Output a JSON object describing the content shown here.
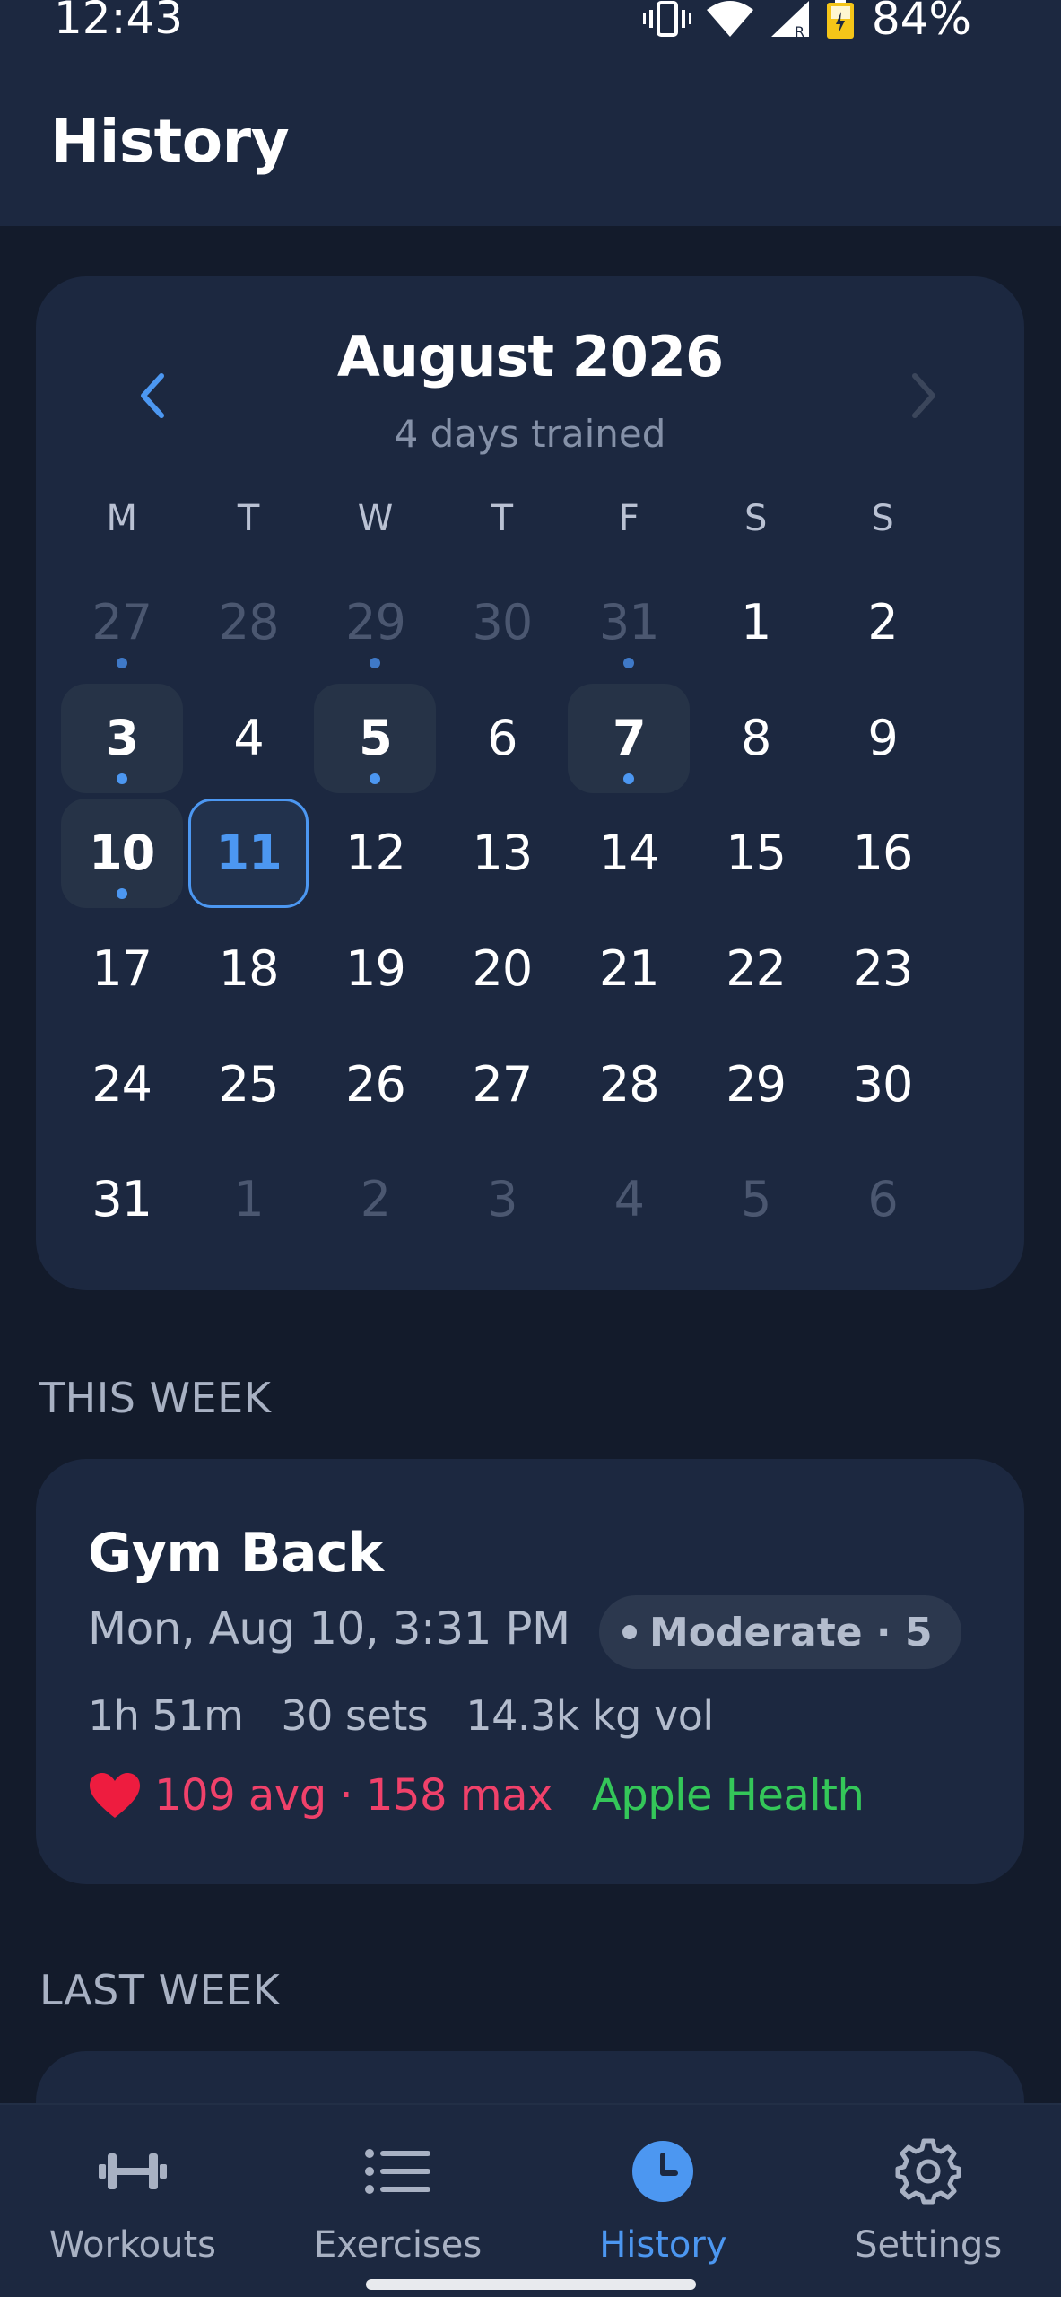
{
  "status_bar": {
    "time": "12:43",
    "battery": "84%"
  },
  "app_bar": {
    "title": "History"
  },
  "calendar": {
    "month_label": "August 2026",
    "subtitle": "4 days trained",
    "weekdays": [
      "M",
      "T",
      "W",
      "T",
      "F",
      "S",
      "S"
    ],
    "days": [
      {
        "label": "27",
        "other": true,
        "dot": true
      },
      {
        "label": "28",
        "other": true
      },
      {
        "label": "29",
        "other": true,
        "dot": true
      },
      {
        "label": "30",
        "other": true
      },
      {
        "label": "31",
        "other": true,
        "dot": true
      },
      {
        "label": "1"
      },
      {
        "label": "2"
      },
      {
        "label": "3",
        "trained": true,
        "dot": true
      },
      {
        "label": "4"
      },
      {
        "label": "5",
        "trained": true,
        "dot": true
      },
      {
        "label": "6"
      },
      {
        "label": "7",
        "trained": true,
        "dot": true
      },
      {
        "label": "8"
      },
      {
        "label": "9"
      },
      {
        "label": "10",
        "trained": true,
        "dot": true
      },
      {
        "label": "11",
        "today": true
      },
      {
        "label": "12"
      },
      {
        "label": "13"
      },
      {
        "label": "14"
      },
      {
        "label": "15"
      },
      {
        "label": "16"
      },
      {
        "label": "17"
      },
      {
        "label": "18"
      },
      {
        "label": "19"
      },
      {
        "label": "20"
      },
      {
        "label": "21"
      },
      {
        "label": "22"
      },
      {
        "label": "23"
      },
      {
        "label": "24"
      },
      {
        "label": "25"
      },
      {
        "label": "26"
      },
      {
        "label": "27"
      },
      {
        "label": "28"
      },
      {
        "label": "29"
      },
      {
        "label": "30"
      },
      {
        "label": "31"
      },
      {
        "label": "1",
        "other": true
      },
      {
        "label": "2",
        "other": true
      },
      {
        "label": "3",
        "other": true
      },
      {
        "label": "4",
        "other": true
      },
      {
        "label": "5",
        "other": true
      },
      {
        "label": "6",
        "other": true
      }
    ]
  },
  "sections": {
    "this_week": "THIS WEEK",
    "last_week": "LAST WEEK"
  },
  "workout": {
    "title": "Gym Back",
    "date": "Mon, Aug 10, 3:31 PM",
    "intensity": "Moderate · 5",
    "duration": "1h 51m",
    "sets": "30 sets",
    "volume": "14.3k kg vol",
    "heart_rate": "109 avg · 158 max",
    "source": "Apple Health"
  },
  "nav": {
    "items": [
      {
        "label": "Workouts",
        "icon": "dumbbell-icon"
      },
      {
        "label": "Exercises",
        "icon": "list-icon"
      },
      {
        "label": "History",
        "icon": "clock-icon",
        "active": true
      },
      {
        "label": "Settings",
        "icon": "gear-icon"
      }
    ]
  },
  "colors": {
    "background": "#131b2b",
    "surface": "#1c2840",
    "accent": "#4c97f1",
    "heart": "#f0416a",
    "apple_health": "#34c759"
  }
}
